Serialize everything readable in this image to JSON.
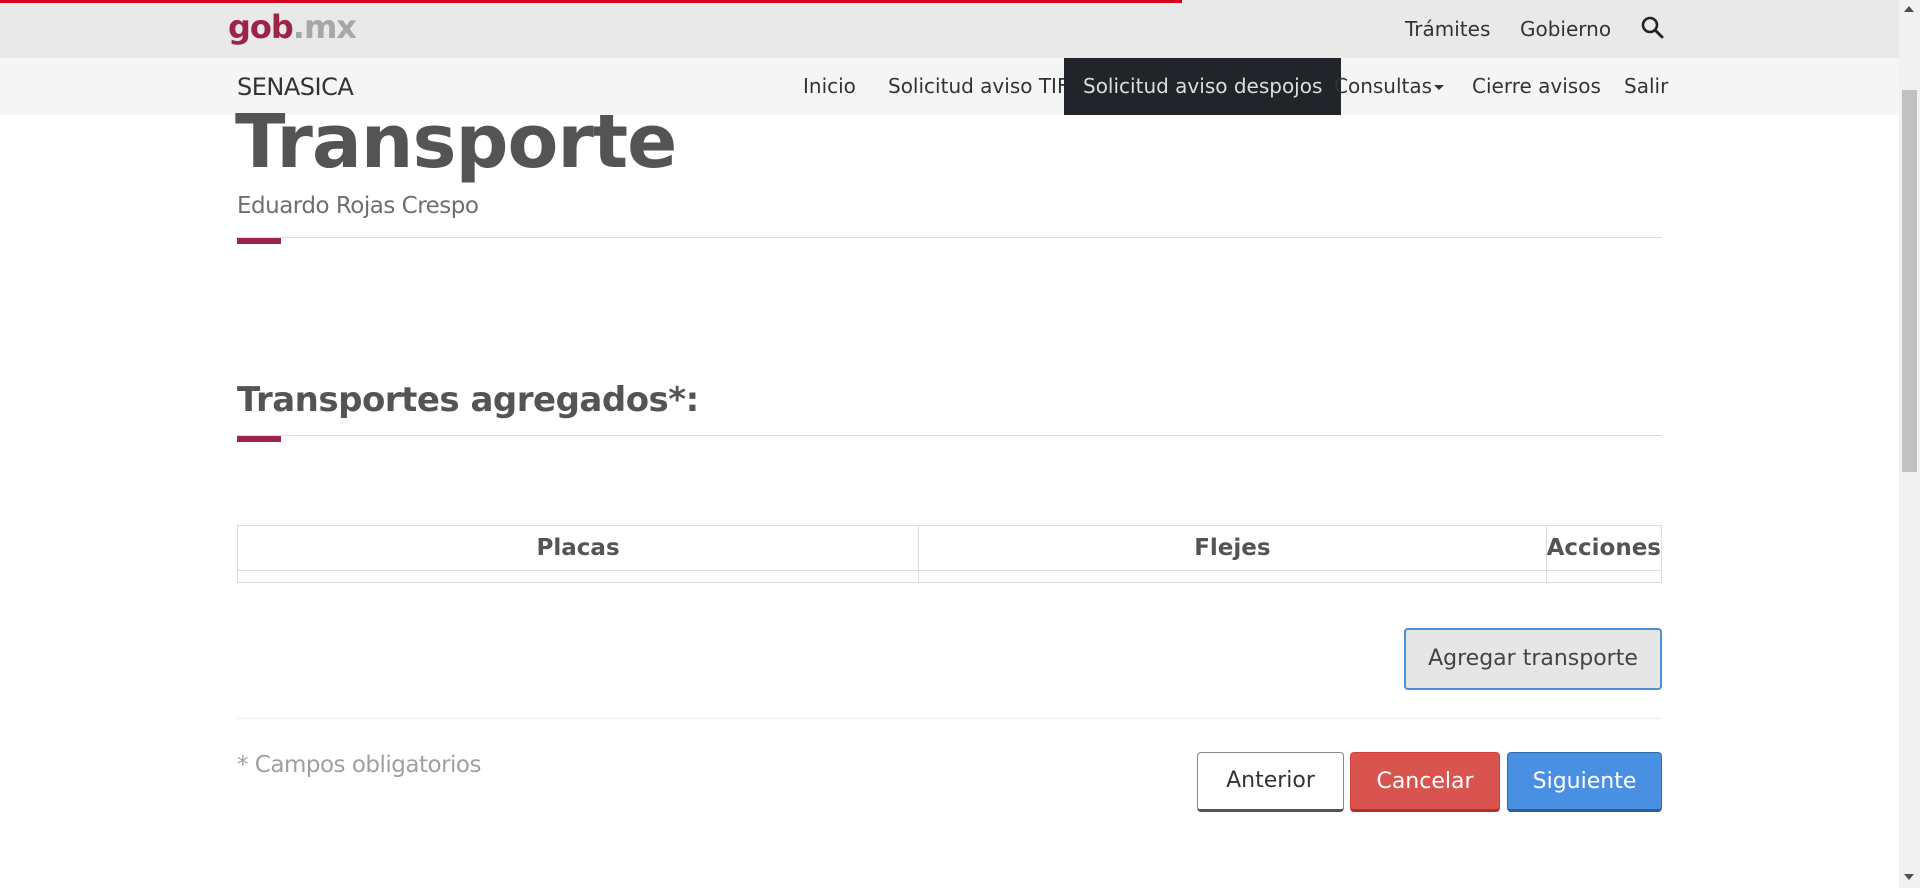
{
  "window": {
    "title": "Transporte"
  },
  "topbar": {
    "logo_gob": "gob",
    "logo_mx": ".mx",
    "links": [
      "Trámites",
      "Gobierno"
    ],
    "search_icon": "search-icon"
  },
  "subnav": {
    "brand": "SENASICA",
    "items": [
      {
        "label": "Inicio"
      },
      {
        "label": "Solicitud aviso TIF"
      },
      {
        "label": "Solicitud aviso despojos",
        "active": true
      },
      {
        "label": "Consultas"
      },
      {
        "label": "Cierre avisos"
      },
      {
        "label": "Salir"
      }
    ]
  },
  "main": {
    "title": "Transporte",
    "subtitle": "Eduardo Rojas Crespo",
    "section_title": "Transportes agregados*:",
    "table": {
      "headers": [
        "Placas",
        "Flejes",
        "Acciones"
      ],
      "rows": []
    },
    "add_button": "Agregar transporte",
    "required_note": "* Campos obligatorios",
    "buttons": {
      "prev": "Anterior",
      "cancel": "Cancelar",
      "next": "Siguiente"
    }
  },
  "colors": {
    "brand": "#9d2449",
    "loadbar": "#d6001c",
    "danger": "#d9534f",
    "primary": "#4a90e2",
    "active_nav": "#212529"
  }
}
